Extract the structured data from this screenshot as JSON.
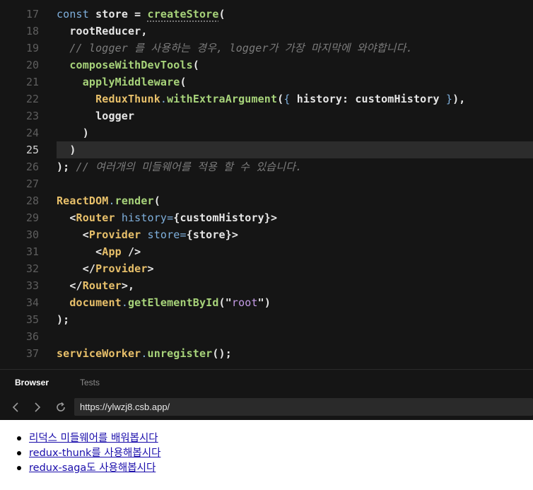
{
  "editor": {
    "active_line": "25",
    "lines": [
      {
        "n": "17",
        "tokens": [
          [
            "k",
            "const "
          ],
          [
            "pl",
            "store = "
          ],
          [
            "fn squiggle",
            "createStore"
          ],
          [
            "pl",
            "("
          ]
        ]
      },
      {
        "n": "18",
        "tokens": [
          [
            "pl",
            "  rootReducer,"
          ]
        ]
      },
      {
        "n": "19",
        "tokens": [
          [
            "cm",
            "  // logger 를 사용하는 경우, logger가 가장 마지막에 와야합니다."
          ]
        ]
      },
      {
        "n": "20",
        "tokens": [
          [
            "fn",
            "  composeWithDevTools"
          ],
          [
            "pl",
            "("
          ]
        ]
      },
      {
        "n": "21",
        "tokens": [
          [
            "fn",
            "    applyMiddleware"
          ],
          [
            "pl",
            "("
          ]
        ]
      },
      {
        "n": "22",
        "tokens": [
          [
            "ty",
            "      ReduxThunk"
          ],
          [
            "pn",
            "."
          ],
          [
            "fn",
            "withExtraArgument"
          ],
          [
            "pl",
            "("
          ],
          [
            "pn",
            "{ "
          ],
          [
            "pl",
            "history: customHistory "
          ],
          [
            "pn",
            "}"
          ],
          [
            "pl",
            "),"
          ]
        ]
      },
      {
        "n": "23",
        "tokens": [
          [
            "pl",
            "      logger"
          ]
        ]
      },
      {
        "n": "24",
        "tokens": [
          [
            "pl",
            "    )"
          ]
        ]
      },
      {
        "n": "25",
        "tokens": [
          [
            "pl",
            "  )"
          ]
        ]
      },
      {
        "n": "26",
        "tokens": [
          [
            "pl",
            ");"
          ],
          [
            "cm",
            " // 여러개의 미들웨어를 적용 할 수 있습니다."
          ]
        ]
      },
      {
        "n": "27",
        "tokens": []
      },
      {
        "n": "28",
        "tokens": [
          [
            "ty",
            "ReactDOM"
          ],
          [
            "pn",
            "."
          ],
          [
            "fn",
            "render"
          ],
          [
            "pl",
            "("
          ]
        ]
      },
      {
        "n": "29",
        "tokens": [
          [
            "pl",
            "  <"
          ],
          [
            "tg",
            "Router"
          ],
          [
            "at",
            " history"
          ],
          [
            "pn",
            "="
          ],
          [
            "pl",
            "{customHistory}>"
          ]
        ]
      },
      {
        "n": "30",
        "tokens": [
          [
            "pl",
            "    <"
          ],
          [
            "tg",
            "Provider"
          ],
          [
            "at",
            " store"
          ],
          [
            "pn",
            "="
          ],
          [
            "pl",
            "{store}>"
          ]
        ]
      },
      {
        "n": "31",
        "tokens": [
          [
            "pl",
            "      <"
          ],
          [
            "tg",
            "App"
          ],
          [
            "pl",
            " />"
          ]
        ]
      },
      {
        "n": "32",
        "tokens": [
          [
            "pl",
            "    </"
          ],
          [
            "tg",
            "Provider"
          ],
          [
            "pl",
            ">"
          ]
        ]
      },
      {
        "n": "33",
        "tokens": [
          [
            "pl",
            "  </"
          ],
          [
            "tg",
            "Router"
          ],
          [
            "pl",
            ">,"
          ]
        ]
      },
      {
        "n": "34",
        "tokens": [
          [
            "ty",
            "  document"
          ],
          [
            "pn",
            "."
          ],
          [
            "fn",
            "getElementById"
          ],
          [
            "pl",
            "(\""
          ],
          [
            "st",
            "root"
          ],
          [
            "pl",
            "\")"
          ]
        ]
      },
      {
        "n": "35",
        "tokens": [
          [
            "pl",
            ");"
          ]
        ]
      },
      {
        "n": "36",
        "tokens": []
      },
      {
        "n": "37",
        "tokens": [
          [
            "ty",
            "serviceWorker"
          ],
          [
            "pn",
            "."
          ],
          [
            "fn",
            "unregister"
          ],
          [
            "pl",
            "();"
          ]
        ]
      }
    ]
  },
  "preview": {
    "tabs": [
      {
        "label": "Browser",
        "active": true
      },
      {
        "label": "Tests",
        "active": false
      }
    ],
    "nav": {
      "back_icon": "chevron-left-icon",
      "forward_icon": "chevron-right-icon",
      "refresh_icon": "refresh-icon",
      "url": "https://ylwzj8.csb.app/"
    },
    "links": [
      "리덕스 미들웨어를 배워봅시다",
      "redux-thunk를 사용해봅시다",
      "redux-saga도 사용해봅시다"
    ]
  },
  "colors": {
    "editor_bg": "#151515",
    "active_line_bg": "#2c2c2c",
    "link": "#1a0dab"
  }
}
